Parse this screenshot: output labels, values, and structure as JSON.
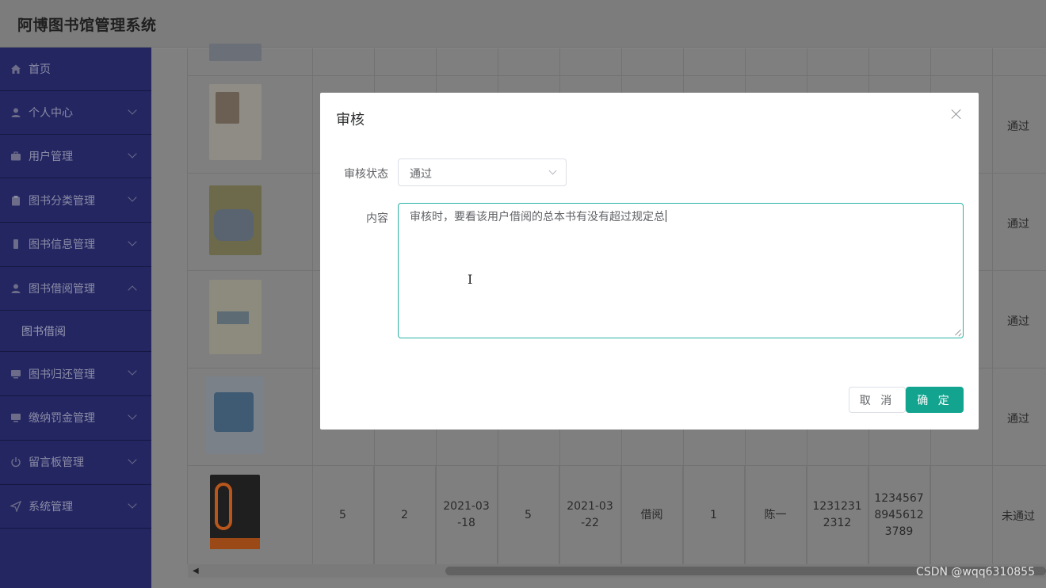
{
  "app": {
    "title": "阿博图书馆管理系统"
  },
  "sidebar": {
    "items": [
      {
        "label": "首页",
        "icon": "home-icon"
      },
      {
        "label": "个人中心",
        "icon": "user-icon"
      },
      {
        "label": "用户管理",
        "icon": "briefcase-icon"
      },
      {
        "label": "图书分类管理",
        "icon": "clipboard-icon"
      },
      {
        "label": "图书信息管理",
        "icon": "mobile-icon"
      },
      {
        "label": "图书借阅管理",
        "icon": "user-icon",
        "expanded": true
      },
      {
        "label": "图书归还管理",
        "icon": "monitor-icon"
      },
      {
        "label": "缴纳罚金管理",
        "icon": "monitor-icon"
      },
      {
        "label": "留言板管理",
        "icon": "power-icon"
      },
      {
        "label": "系统管理",
        "icon": "send-icon"
      }
    ],
    "submenu": {
      "label": "图书借阅"
    }
  },
  "table": {
    "rows": [
      {
        "status": "通过"
      },
      {
        "status": "通过"
      },
      {
        "status": "通过"
      },
      {
        "status": "通过"
      },
      {
        "cells": [
          "5",
          "2",
          "2021-03-18",
          "5",
          "2021-03-22",
          "借阅",
          "1",
          "陈一",
          "12312312312",
          "12345678945612 3789"
        ],
        "cells_display": [
          "5",
          "2",
          "2021-03\n-18",
          "5",
          "2021-03\n-22",
          "借阅",
          "1",
          "陈一",
          "1231231\n2312",
          "1234567\n8945612\n3789"
        ],
        "status": "未通过"
      }
    ]
  },
  "dialog": {
    "title": "审核",
    "status_label": "审核状态",
    "status_value": "通过",
    "content_label": "内容",
    "content_value": "审核时，要看该用户借阅的总本书有没有超过规定总",
    "cancel_label": "取 消",
    "ok_label": "确 定"
  },
  "watermark": "CSDN @wqq6310855",
  "colors": {
    "sidebar": "#232661",
    "primary": "#13a48f",
    "focus": "#2bb3a6"
  }
}
